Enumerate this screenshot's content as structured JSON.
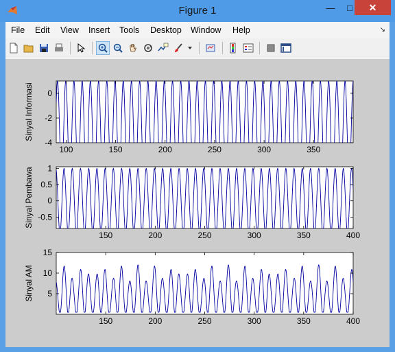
{
  "window": {
    "title": "Figure 1",
    "min_glyph": "—",
    "max_glyph": "□",
    "close_glyph": "✕"
  },
  "menubar": {
    "items": [
      "File",
      "Edit",
      "View",
      "Insert",
      "Tools",
      "Desktop",
      "Window",
      "Help"
    ],
    "corner_glyph": "↘"
  },
  "toolbar": {
    "buttons": [
      {
        "icon": "new-figure-icon"
      },
      {
        "icon": "open-file-icon"
      },
      {
        "icon": "save-icon"
      },
      {
        "icon": "print-icon"
      },
      {
        "icon": "edit-plot-arrow-icon"
      },
      {
        "icon": "zoom-in-icon",
        "active": true
      },
      {
        "icon": "zoom-out-icon"
      },
      {
        "icon": "pan-hand-icon"
      },
      {
        "icon": "rotate-3d-icon"
      },
      {
        "icon": "data-cursor-icon"
      },
      {
        "icon": "brush-icon"
      },
      {
        "icon": "brush-dropdown-icon"
      },
      {
        "icon": "link-plot-icon"
      },
      {
        "icon": "colorbar-icon"
      },
      {
        "icon": "legend-icon"
      },
      {
        "icon": "hide-plot-tools-icon"
      },
      {
        "icon": "show-plot-tools-icon"
      }
    ]
  },
  "colors": {
    "line": "#0000a0",
    "figure_bg": "#cccccc",
    "axes_bg": "#ffffff"
  },
  "chart_data": [
    {
      "type": "line",
      "ylabel": "Sinyal Informasi",
      "xlim": [
        90,
        390
      ],
      "ylim": [
        -4,
        1
      ],
      "xticks": [
        100,
        150,
        200,
        250,
        300,
        350
      ],
      "yticks": [
        -4,
        -2,
        0
      ],
      "series": [
        {
          "function": "4*cos(2*pi*x/8.3)-3",
          "x_range": [
            90,
            390
          ]
        }
      ]
    },
    {
      "type": "line",
      "ylabel": "Sinyal Pembawa",
      "xlim": [
        100,
        400
      ],
      "ylim": [
        -0.85,
        1.05
      ],
      "xticks": [
        150,
        200,
        250,
        300,
        350,
        400
      ],
      "yticks": [
        -0.5,
        0,
        0.5,
        1
      ],
      "series": [
        {
          "function": "cos(2*pi*x/8.3)",
          "x_range": [
            100,
            400
          ]
        }
      ]
    },
    {
      "type": "line",
      "ylabel": "Sinyal AM",
      "xlim": [
        100,
        400
      ],
      "ylim": [
        0,
        15
      ],
      "xticks": [
        150,
        200,
        250,
        300,
        350,
        400
      ],
      "yticks": [
        5,
        10,
        15
      ],
      "series": [
        {
          "function": "8+4*cos(2*pi*x/8.3), modulated envelope peaks ~8 and ~12",
          "x_range": [
            100,
            400
          ]
        }
      ]
    }
  ]
}
